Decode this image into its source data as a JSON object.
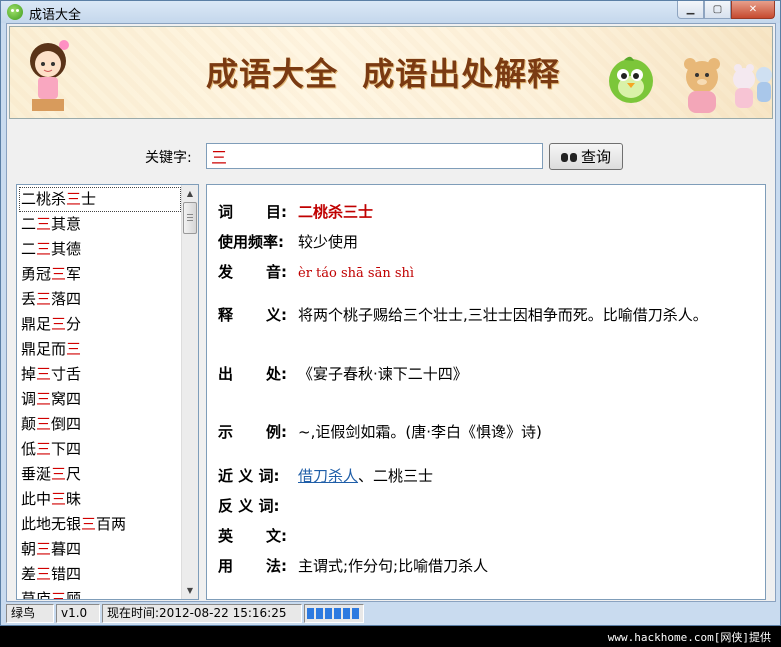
{
  "window": {
    "title": "成语大全"
  },
  "banner": {
    "title": "成语大全  成语出处解释"
  },
  "search": {
    "label": "关键字:",
    "value": "三",
    "button_label": "查询"
  },
  "idiom_list": [
    [
      "二桃杀",
      "三",
      "士"
    ],
    [
      "二",
      "三",
      "其意"
    ],
    [
      "二",
      "三",
      "其德"
    ],
    [
      "勇冠",
      "三",
      "军"
    ],
    [
      "丢",
      "三",
      "落四"
    ],
    [
      "鼎足",
      "三",
      "分"
    ],
    [
      "鼎足而",
      "三",
      ""
    ],
    [
      "掉",
      "三",
      "寸舌"
    ],
    [
      "调",
      "三",
      "窝四"
    ],
    [
      "颠",
      "三",
      "倒四"
    ],
    [
      "低",
      "三",
      "下四"
    ],
    [
      "垂涎",
      "三",
      "尺"
    ],
    [
      "此中",
      "三",
      "昧"
    ],
    [
      "此地无银",
      "三",
      "百两"
    ],
    [
      "朝",
      "三",
      "暮四"
    ],
    [
      "差",
      "三",
      "错四"
    ],
    [
      "草庐",
      "三",
      "顾"
    ]
  ],
  "detail": {
    "labels": {
      "word": [
        "词",
        "目:"
      ],
      "frequency": [
        "使用频率:"
      ],
      "pronunciation": [
        "发",
        "音:"
      ],
      "meaning": [
        "释",
        "义:"
      ],
      "source": [
        "出",
        "处:"
      ],
      "example": [
        "示",
        "例:"
      ],
      "synonym": [
        "近 义 词:"
      ],
      "antonym": [
        "反 义 词:"
      ],
      "english": [
        "英",
        "文:"
      ],
      "usage": [
        "用",
        "法:"
      ]
    },
    "word": "二桃杀三士",
    "frequency": "较少使用",
    "pronunciation": "èr táo shā sān shì",
    "meaning": "将两个桃子赐给三个壮士,三壮士因相争而死。比喻借刀杀人。",
    "source": "《宴子春秋·谏下二十四》",
    "example": "~,讵假剑如霜。(唐·李白《惧谗》诗)",
    "synonym_link": "借刀杀人",
    "synonym_rest": "、二桃三士",
    "antonym": "",
    "english": "",
    "usage": "主谓式;作分句;比喻借刀杀人"
  },
  "status": {
    "name": "绿鸟",
    "version": "v1.0",
    "time": "现在时间:2012-08-22 15:16:25",
    "progress": 0.85
  },
  "footer": {
    "text": "www.hackhome.com[网侠]提供"
  }
}
